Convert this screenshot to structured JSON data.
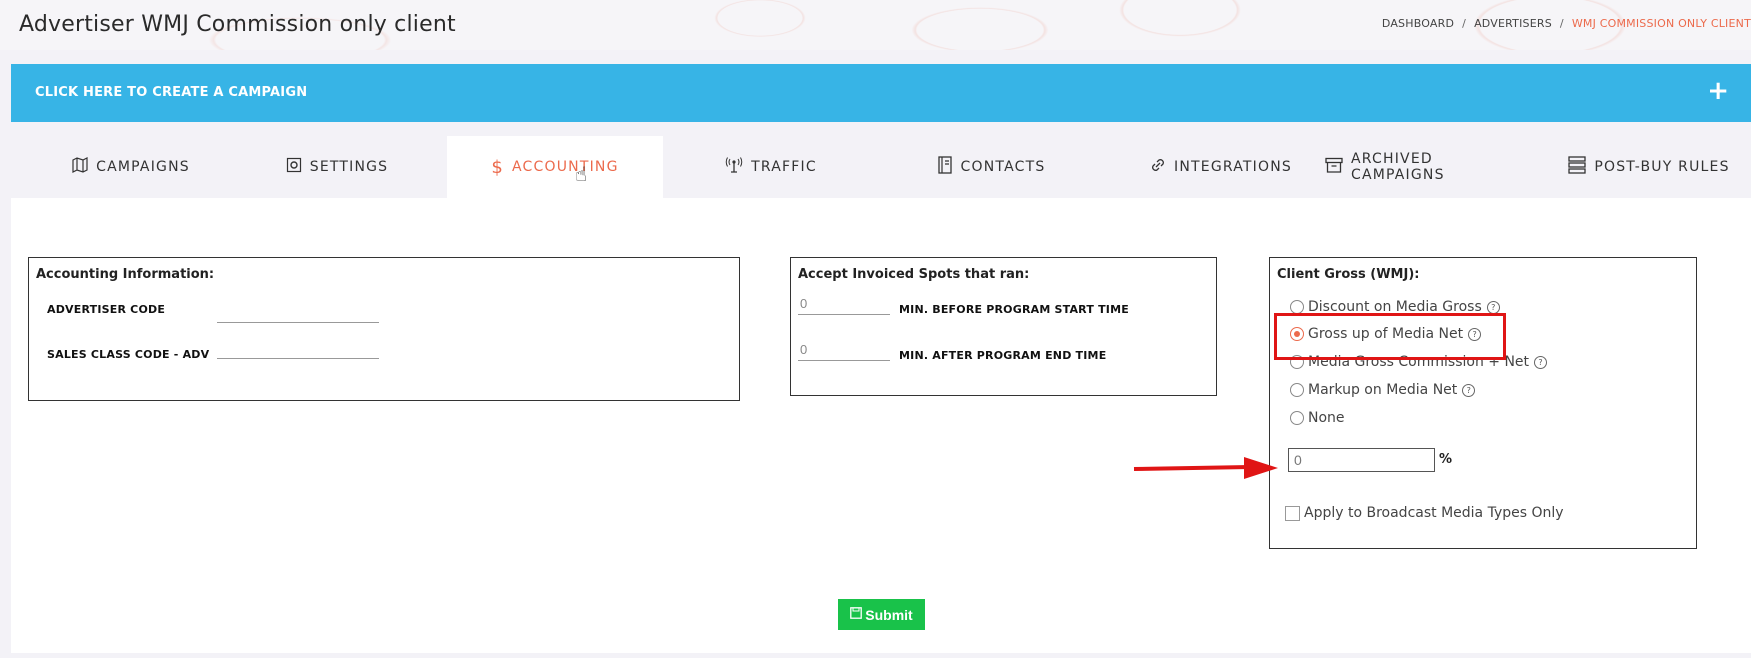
{
  "header": {
    "title": "Advertiser WMJ Commission only client",
    "breadcrumb": [
      "DASHBOARD",
      "ADVERTISERS",
      "WMJ COMMISSION ONLY CLIENT"
    ],
    "breadcrumb_sep": "/"
  },
  "banner": {
    "label": "CLICK HERE TO CREATE A CAMPAIGN",
    "plus": "+"
  },
  "tabs": [
    {
      "label": "CAMPAIGNS",
      "icon": "map-icon"
    },
    {
      "label": "SETTINGS",
      "icon": "gear-icon"
    },
    {
      "label": "ACCOUNTING",
      "icon": "dollar-icon",
      "active": true
    },
    {
      "label": "TRAFFIC",
      "icon": "antenna-icon"
    },
    {
      "label": "CONTACTS",
      "icon": "contacts-book-icon"
    },
    {
      "label": "INTEGRATIONS",
      "icon": "link-icon"
    },
    {
      "label": "ARCHIVED CAMPAIGNS",
      "icon": "archive-icon"
    },
    {
      "label": "POST-BUY RULES",
      "icon": "list-icon"
    }
  ],
  "accounting": {
    "title": "Accounting Information:",
    "advertiser_code_label": "ADVERTISER CODE",
    "advertiser_code_value": "",
    "sales_class_label": "SALES CLASS CODE - ADV",
    "sales_class_value": ""
  },
  "spots": {
    "title": "Accept Invoiced Spots that ran:",
    "before_value": "0",
    "before_label": "MIN. BEFORE PROGRAM START TIME",
    "after_value": "0",
    "after_label": "MIN. AFTER PROGRAM END TIME"
  },
  "client_gross": {
    "title": "Client Gross (WMJ):",
    "options": [
      {
        "label": "Discount on Media Gross",
        "help": true,
        "checked": false
      },
      {
        "label": "Gross up of Media Net",
        "help": true,
        "checked": true
      },
      {
        "label": "Media Gross Commission + Net",
        "help": true,
        "checked": false
      },
      {
        "label": "Markup on Media Net",
        "help": true,
        "checked": false
      },
      {
        "label": "None",
        "help": false,
        "checked": false
      }
    ],
    "percent_value": "0",
    "percent_sign": "%",
    "broadcast_label": "Apply to Broadcast Media Types Only",
    "broadcast_checked": false
  },
  "submit": {
    "label": "Submit"
  },
  "colors": {
    "accent": "#ec6a4c",
    "banner": "#37b4e6",
    "submit": "#19c24a",
    "highlight": "#e01515"
  }
}
